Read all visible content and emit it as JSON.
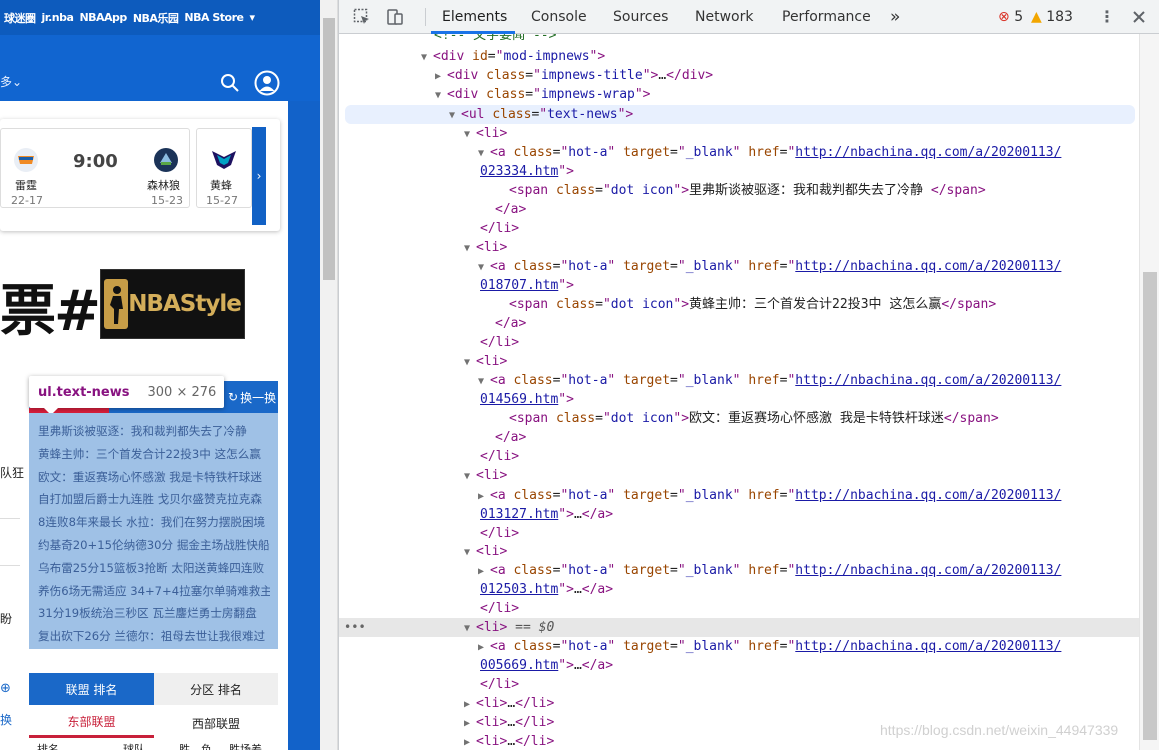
{
  "site": {
    "top_links": [
      "球迷圈",
      "jr.nba",
      "NBAApp",
      "NBA乐园",
      "NBA Store"
    ],
    "more_label": "多",
    "brand_blue": "#1165d0",
    "games": [
      {
        "home": "雷霆",
        "home_record": "22-17",
        "away": "森林狼",
        "away_record": "15-23",
        "time": "9:00"
      },
      {
        "home": "黄蜂",
        "home_record": "15-27"
      }
    ],
    "next_arrow": "›",
    "ticket_text": "票#",
    "nbastyle_text": "NBAStyle",
    "tooltip": {
      "name": "ul.text-news",
      "size": "300 × 276"
    },
    "refresh_label": "换一换",
    "news": [
      "里弗斯谈被驱逐：我和裁判都失去了冷静",
      "黄蜂主帅：三个首发合计22投3中 这怎么赢",
      "欧文：重返赛场心怀感激 我是卡特铁杆球迷",
      "自打加盟后爵士九连胜 戈贝尔盛赞克拉克森",
      "8连败8年来最长 水拉：我们在努力摆脱困境",
      "约基奇20+15伦纳德30分 掘金主场战胜快船",
      "乌布雷25分15篮板3抢断 太阳送黄蜂四连败",
      "养伤6场无需适应 34+7+4拉塞尔单骑难救主",
      "31分19板统治三秒区 瓦兰鏖烂勇士房翻盘",
      "复出砍下26分 兰德尔：祖母去世让我很难过"
    ],
    "edge_texts": [
      "队狂",
      "盼",
      "换"
    ],
    "edge_icon": "⊕",
    "rank_tabs": [
      "联盟 排名",
      "分区 排名"
    ],
    "conf_tabs": [
      "东部联盟",
      "西部联盟"
    ],
    "standings_headers": [
      "排名",
      "球队",
      "胜",
      "负",
      "胜场差"
    ]
  },
  "devtools": {
    "tabs": [
      "Elements",
      "Console",
      "Sources",
      "Network",
      "Performance"
    ],
    "overflow_label": "»",
    "errors": "5",
    "warnings": "183",
    "active_tab": "Elements",
    "accent": "#1a73e8",
    "dom": {
      "comment": "<!-- 文字要闻 -->",
      "div_mod": {
        "tag": "div",
        "attr": "id",
        "value": "mod-impnews"
      },
      "div_title": {
        "tag": "div",
        "attr": "class",
        "value": "impnews-title",
        "ellipsis": "…"
      },
      "div_wrap": {
        "tag": "div",
        "attr": "class",
        "value": "impnews-wrap"
      },
      "ul": {
        "tag": "ul",
        "attr": "class",
        "value": "text-news"
      },
      "items": [
        {
          "href1": "http://nbachina.qq.com/a/20200113/",
          "href2": "023334.htm",
          "text": "里弗斯谈被驱逐：我和裁判都失去了冷静 ",
          "expanded": true
        },
        {
          "href1": "http://nbachina.qq.com/a/20200113/",
          "href2": "018707.htm",
          "text": "黄蜂主帅：三个首发合计22投3中 这怎么赢",
          "expanded": true
        },
        {
          "href1": "http://nbachina.qq.com/a/20200113/",
          "href2": "014569.htm",
          "text": "欧文：重返赛场心怀感激 我是卡特铁杆球迷",
          "expanded": true
        },
        {
          "href1": "http://nbachina.qq.com/a/20200113/",
          "href2": "013127.htm",
          "expanded": false
        },
        {
          "href1": "http://nbachina.qq.com/a/20200113/",
          "href2": "012503.htm",
          "expanded": false
        },
        {
          "href1": "http://nbachina.qq.com/a/20200113/",
          "href2": "005669.htm",
          "expanded": false,
          "selected": true
        }
      ],
      "a_class": "hot-a",
      "a_target": "_blank",
      "span_class": "dot icon",
      "selected_marker": "== $0",
      "collapsed_li": "…"
    },
    "watermark": "https://blog.csdn.net/weixin_44947339"
  }
}
